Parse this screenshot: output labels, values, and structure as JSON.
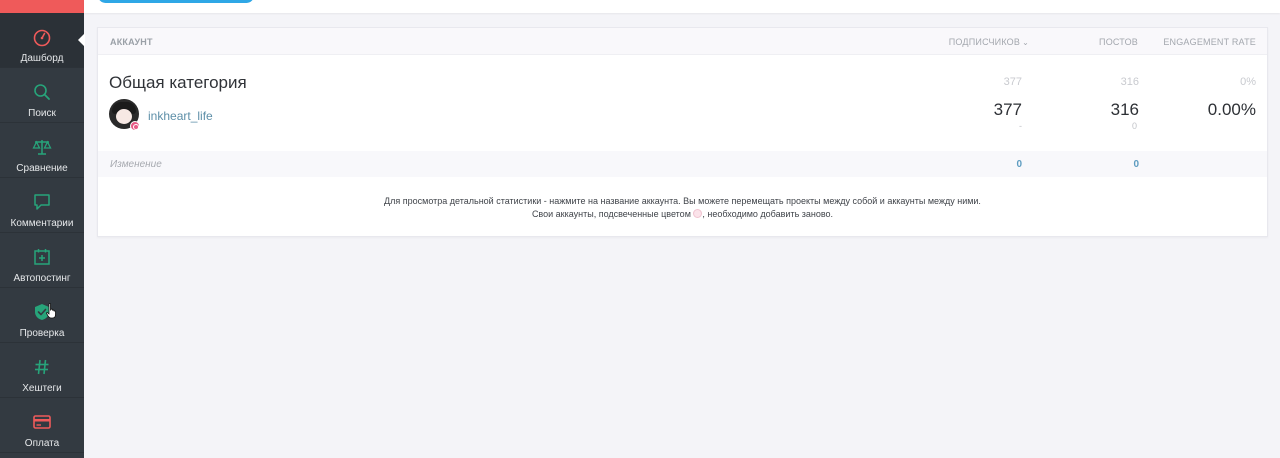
{
  "sidebar": {
    "accent_color": "#ef5a5a",
    "items": [
      {
        "label": "Дашборд",
        "icon": "speedometer-icon",
        "active": true
      },
      {
        "label": "Поиск",
        "icon": "search-icon"
      },
      {
        "label": "Сравнение",
        "icon": "scales-icon"
      },
      {
        "label": "Комментарии",
        "icon": "comment-icon"
      },
      {
        "label": "Автопостинг",
        "icon": "calendar-plus-icon"
      },
      {
        "label": "Проверка",
        "icon": "shield-check-icon"
      },
      {
        "label": "Хештеги",
        "icon": "hashtag-icon"
      },
      {
        "label": "Оплата",
        "icon": "credit-card-icon"
      }
    ]
  },
  "table": {
    "headers": {
      "account": "АККАУНТ",
      "subscribers": "ПОДПИСЧИКОВ",
      "posts": "ПОСТОВ",
      "engagement": "ENGAGEMENT RATE"
    },
    "category": {
      "title": "Общая категория",
      "subscribers": "377",
      "posts": "316",
      "engagement": "0%"
    },
    "account_row": {
      "name": "inkheart_life",
      "subscribers": "377",
      "subscribers_change": "-",
      "posts": "316",
      "posts_change": "0",
      "engagement": "0.00%"
    },
    "change_row": {
      "label": "Изменение",
      "subscribers": "0",
      "posts": "0"
    }
  },
  "info": {
    "line1": "Для просмотра детальной статистики - нажмите на название аккаунта. Вы можете перемещать проекты между собой и аккаунты между ними.",
    "line2_before": "Свои аккаунты, подсвеченные цветом",
    "line2_after": ", необходимо добавить заново."
  },
  "colors": {
    "sidebar_bg": "#333a41",
    "icon_green": "#27a47a",
    "icon_red": "#ef5a5a",
    "primary_blue": "#2fa7e6",
    "link": "#5d8fa8"
  }
}
